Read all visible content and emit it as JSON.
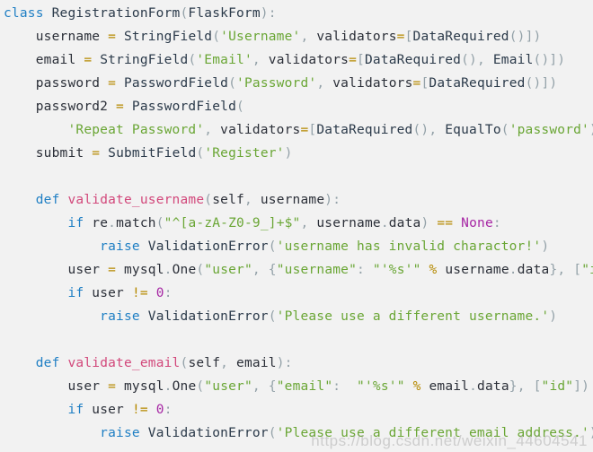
{
  "editor": {
    "background_color": "#f2f2f2",
    "language": "python",
    "font_size_px": 14.5,
    "line_height_px": 26
  },
  "colors": {
    "keyword": "#1f7fc4",
    "function_name": "#d2487b",
    "string": "#6aa635",
    "number": "#a626a4",
    "operator": "#b58900",
    "punctuation": "#93a1a8",
    "identifier": "#2b2f38",
    "background": "#f2f2f2",
    "watermark": "#a0a0a0"
  },
  "watermark": {
    "text": "https://blog.csdn.net/weixin_44604541"
  },
  "code": {
    "lines": [
      {
        "index": 1,
        "text": "class RegistrationForm(FlaskForm):",
        "tokens": [
          {
            "t": "class",
            "c": "tok-kw"
          },
          {
            "t": " ",
            "c": "tok-plain"
          },
          {
            "t": "RegistrationForm",
            "c": "tok-cls"
          },
          {
            "t": "(",
            "c": "tok-punc"
          },
          {
            "t": "FlaskForm",
            "c": "tok-cls"
          },
          {
            "t": ")",
            "c": "tok-punc"
          },
          {
            "t": ":",
            "c": "tok-punc"
          }
        ]
      },
      {
        "index": 2,
        "text": "    username = StringField('Username', validators=[DataRequired()])",
        "tokens": [
          {
            "t": "    ",
            "c": "tok-plain"
          },
          {
            "t": "username",
            "c": "tok-name"
          },
          {
            "t": " ",
            "c": "tok-plain"
          },
          {
            "t": "=",
            "c": "tok-op"
          },
          {
            "t": " ",
            "c": "tok-plain"
          },
          {
            "t": "StringField",
            "c": "tok-cls"
          },
          {
            "t": "(",
            "c": "tok-punc"
          },
          {
            "t": "'Username'",
            "c": "tok-str"
          },
          {
            "t": ",",
            "c": "tok-punc"
          },
          {
            "t": " ",
            "c": "tok-plain"
          },
          {
            "t": "validators",
            "c": "tok-name"
          },
          {
            "t": "=",
            "c": "tok-op"
          },
          {
            "t": "[",
            "c": "tok-punc"
          },
          {
            "t": "DataRequired",
            "c": "tok-cls"
          },
          {
            "t": "()])",
            "c": "tok-punc"
          }
        ]
      },
      {
        "index": 3,
        "text": "    email = StringField('Email', validators=[DataRequired(), Email()])",
        "tokens": [
          {
            "t": "    ",
            "c": "tok-plain"
          },
          {
            "t": "email",
            "c": "tok-name"
          },
          {
            "t": " ",
            "c": "tok-plain"
          },
          {
            "t": "=",
            "c": "tok-op"
          },
          {
            "t": " ",
            "c": "tok-plain"
          },
          {
            "t": "StringField",
            "c": "tok-cls"
          },
          {
            "t": "(",
            "c": "tok-punc"
          },
          {
            "t": "'Email'",
            "c": "tok-str"
          },
          {
            "t": ",",
            "c": "tok-punc"
          },
          {
            "t": " ",
            "c": "tok-plain"
          },
          {
            "t": "validators",
            "c": "tok-name"
          },
          {
            "t": "=",
            "c": "tok-op"
          },
          {
            "t": "[",
            "c": "tok-punc"
          },
          {
            "t": "DataRequired",
            "c": "tok-cls"
          },
          {
            "t": "(), ",
            "c": "tok-punc"
          },
          {
            "t": "Email",
            "c": "tok-cls"
          },
          {
            "t": "()])",
            "c": "tok-punc"
          }
        ]
      },
      {
        "index": 4,
        "text": "    password = PasswordField('Password', validators=[DataRequired()])",
        "tokens": [
          {
            "t": "    ",
            "c": "tok-plain"
          },
          {
            "t": "password",
            "c": "tok-name"
          },
          {
            "t": " ",
            "c": "tok-plain"
          },
          {
            "t": "=",
            "c": "tok-op"
          },
          {
            "t": " ",
            "c": "tok-plain"
          },
          {
            "t": "PasswordField",
            "c": "tok-cls"
          },
          {
            "t": "(",
            "c": "tok-punc"
          },
          {
            "t": "'Password'",
            "c": "tok-str"
          },
          {
            "t": ",",
            "c": "tok-punc"
          },
          {
            "t": " ",
            "c": "tok-plain"
          },
          {
            "t": "validators",
            "c": "tok-name"
          },
          {
            "t": "=",
            "c": "tok-op"
          },
          {
            "t": "[",
            "c": "tok-punc"
          },
          {
            "t": "DataRequired",
            "c": "tok-cls"
          },
          {
            "t": "()])",
            "c": "tok-punc"
          }
        ]
      },
      {
        "index": 5,
        "text": "    password2 = PasswordField(",
        "tokens": [
          {
            "t": "    ",
            "c": "tok-plain"
          },
          {
            "t": "password2",
            "c": "tok-name"
          },
          {
            "t": " ",
            "c": "tok-plain"
          },
          {
            "t": "=",
            "c": "tok-op"
          },
          {
            "t": " ",
            "c": "tok-plain"
          },
          {
            "t": "PasswordField",
            "c": "tok-cls"
          },
          {
            "t": "(",
            "c": "tok-punc"
          }
        ]
      },
      {
        "index": 6,
        "text": "        'Repeat Password', validators=[DataRequired(), EqualTo('password')])",
        "tokens": [
          {
            "t": "        ",
            "c": "tok-plain"
          },
          {
            "t": "'Repeat Password'",
            "c": "tok-str"
          },
          {
            "t": ",",
            "c": "tok-punc"
          },
          {
            "t": " ",
            "c": "tok-plain"
          },
          {
            "t": "validators",
            "c": "tok-name"
          },
          {
            "t": "=",
            "c": "tok-op"
          },
          {
            "t": "[",
            "c": "tok-punc"
          },
          {
            "t": "DataRequired",
            "c": "tok-cls"
          },
          {
            "t": "(), ",
            "c": "tok-punc"
          },
          {
            "t": "EqualTo",
            "c": "tok-cls"
          },
          {
            "t": "(",
            "c": "tok-punc"
          },
          {
            "t": "'password'",
            "c": "tok-str"
          },
          {
            "t": ")])",
            "c": "tok-punc"
          }
        ]
      },
      {
        "index": 7,
        "text": "    submit = SubmitField('Register')",
        "tokens": [
          {
            "t": "    ",
            "c": "tok-plain"
          },
          {
            "t": "submit",
            "c": "tok-name"
          },
          {
            "t": " ",
            "c": "tok-plain"
          },
          {
            "t": "=",
            "c": "tok-op"
          },
          {
            "t": " ",
            "c": "tok-plain"
          },
          {
            "t": "SubmitField",
            "c": "tok-cls"
          },
          {
            "t": "(",
            "c": "tok-punc"
          },
          {
            "t": "'Register'",
            "c": "tok-str"
          },
          {
            "t": ")",
            "c": "tok-punc"
          }
        ]
      },
      {
        "index": 8,
        "text": "",
        "tokens": []
      },
      {
        "index": 9,
        "text": "    def validate_username(self, username):",
        "tokens": [
          {
            "t": "    ",
            "c": "tok-plain"
          },
          {
            "t": "def",
            "c": "tok-kw"
          },
          {
            "t": " ",
            "c": "tok-plain"
          },
          {
            "t": "validate_username",
            "c": "tok-fname"
          },
          {
            "t": "(",
            "c": "tok-punc"
          },
          {
            "t": "self",
            "c": "tok-name"
          },
          {
            "t": ",",
            "c": "tok-punc"
          },
          {
            "t": " ",
            "c": "tok-plain"
          },
          {
            "t": "username",
            "c": "tok-name"
          },
          {
            "t": "):",
            "c": "tok-punc"
          }
        ]
      },
      {
        "index": 10,
        "text": "        if re.match(\"^[a-zA-Z0-9_]+$\", username.data) == None:",
        "tokens": [
          {
            "t": "        ",
            "c": "tok-plain"
          },
          {
            "t": "if",
            "c": "tok-kw"
          },
          {
            "t": " ",
            "c": "tok-plain"
          },
          {
            "t": "re",
            "c": "tok-name"
          },
          {
            "t": ".",
            "c": "tok-punc"
          },
          {
            "t": "match",
            "c": "tok-name"
          },
          {
            "t": "(",
            "c": "tok-punc"
          },
          {
            "t": "\"^[a-zA-Z0-9_]+$\"",
            "c": "tok-str"
          },
          {
            "t": ",",
            "c": "tok-punc"
          },
          {
            "t": " ",
            "c": "tok-plain"
          },
          {
            "t": "username",
            "c": "tok-name"
          },
          {
            "t": ".",
            "c": "tok-punc"
          },
          {
            "t": "data",
            "c": "tok-name"
          },
          {
            "t": ")",
            "c": "tok-punc"
          },
          {
            "t": " ",
            "c": "tok-plain"
          },
          {
            "t": "==",
            "c": "tok-op"
          },
          {
            "t": " ",
            "c": "tok-plain"
          },
          {
            "t": "None",
            "c": "tok-num"
          },
          {
            "t": ":",
            "c": "tok-punc"
          }
        ]
      },
      {
        "index": 11,
        "text": "            raise ValidationError('username has invalid charactor!')",
        "tokens": [
          {
            "t": "            ",
            "c": "tok-plain"
          },
          {
            "t": "raise",
            "c": "tok-kw"
          },
          {
            "t": " ",
            "c": "tok-plain"
          },
          {
            "t": "ValidationError",
            "c": "tok-cls"
          },
          {
            "t": "(",
            "c": "tok-punc"
          },
          {
            "t": "'username has invalid charactor!'",
            "c": "tok-str"
          },
          {
            "t": ")",
            "c": "tok-punc"
          }
        ]
      },
      {
        "index": 12,
        "text": "        user = mysql.One(\"user\", {\"username\": \"'%s'\" % username.data}, [\"id\"])",
        "tokens": [
          {
            "t": "        ",
            "c": "tok-plain"
          },
          {
            "t": "user",
            "c": "tok-name"
          },
          {
            "t": " ",
            "c": "tok-plain"
          },
          {
            "t": "=",
            "c": "tok-op"
          },
          {
            "t": " ",
            "c": "tok-plain"
          },
          {
            "t": "mysql",
            "c": "tok-name"
          },
          {
            "t": ".",
            "c": "tok-punc"
          },
          {
            "t": "One",
            "c": "tok-name"
          },
          {
            "t": "(",
            "c": "tok-punc"
          },
          {
            "t": "\"user\"",
            "c": "tok-str"
          },
          {
            "t": ", ",
            "c": "tok-punc"
          },
          {
            "t": "{",
            "c": "tok-punc"
          },
          {
            "t": "\"username\"",
            "c": "tok-str"
          },
          {
            "t": ": ",
            "c": "tok-punc"
          },
          {
            "t": "\"'%s'\"",
            "c": "tok-str"
          },
          {
            "t": " ",
            "c": "tok-plain"
          },
          {
            "t": "%",
            "c": "tok-op"
          },
          {
            "t": " ",
            "c": "tok-plain"
          },
          {
            "t": "username",
            "c": "tok-name"
          },
          {
            "t": ".",
            "c": "tok-punc"
          },
          {
            "t": "data",
            "c": "tok-name"
          },
          {
            "t": "}, [",
            "c": "tok-punc"
          },
          {
            "t": "\"id\"",
            "c": "tok-str"
          },
          {
            "t": "])",
            "c": "tok-punc"
          }
        ]
      },
      {
        "index": 13,
        "text": "        if user != 0:",
        "tokens": [
          {
            "t": "        ",
            "c": "tok-plain"
          },
          {
            "t": "if",
            "c": "tok-kw"
          },
          {
            "t": " ",
            "c": "tok-plain"
          },
          {
            "t": "user",
            "c": "tok-name"
          },
          {
            "t": " ",
            "c": "tok-plain"
          },
          {
            "t": "!=",
            "c": "tok-op"
          },
          {
            "t": " ",
            "c": "tok-plain"
          },
          {
            "t": "0",
            "c": "tok-num"
          },
          {
            "t": ":",
            "c": "tok-punc"
          }
        ]
      },
      {
        "index": 14,
        "text": "            raise ValidationError('Please use a different username.')",
        "tokens": [
          {
            "t": "            ",
            "c": "tok-plain"
          },
          {
            "t": "raise",
            "c": "tok-kw"
          },
          {
            "t": " ",
            "c": "tok-plain"
          },
          {
            "t": "ValidationError",
            "c": "tok-cls"
          },
          {
            "t": "(",
            "c": "tok-punc"
          },
          {
            "t": "'Please use a different username.'",
            "c": "tok-str"
          },
          {
            "t": ")",
            "c": "tok-punc"
          }
        ]
      },
      {
        "index": 15,
        "text": "",
        "tokens": []
      },
      {
        "index": 16,
        "text": "    def validate_email(self, email):",
        "tokens": [
          {
            "t": "    ",
            "c": "tok-plain"
          },
          {
            "t": "def",
            "c": "tok-kw"
          },
          {
            "t": " ",
            "c": "tok-plain"
          },
          {
            "t": "validate_email",
            "c": "tok-fname"
          },
          {
            "t": "(",
            "c": "tok-punc"
          },
          {
            "t": "self",
            "c": "tok-name"
          },
          {
            "t": ",",
            "c": "tok-punc"
          },
          {
            "t": " ",
            "c": "tok-plain"
          },
          {
            "t": "email",
            "c": "tok-name"
          },
          {
            "t": "):",
            "c": "tok-punc"
          }
        ]
      },
      {
        "index": 17,
        "text": "        user = mysql.One(\"user\", {\"email\":  \"'%s'\" % email.data}, [\"id\"])",
        "tokens": [
          {
            "t": "        ",
            "c": "tok-plain"
          },
          {
            "t": "user",
            "c": "tok-name"
          },
          {
            "t": " ",
            "c": "tok-plain"
          },
          {
            "t": "=",
            "c": "tok-op"
          },
          {
            "t": " ",
            "c": "tok-plain"
          },
          {
            "t": "mysql",
            "c": "tok-name"
          },
          {
            "t": ".",
            "c": "tok-punc"
          },
          {
            "t": "One",
            "c": "tok-name"
          },
          {
            "t": "(",
            "c": "tok-punc"
          },
          {
            "t": "\"user\"",
            "c": "tok-str"
          },
          {
            "t": ", ",
            "c": "tok-punc"
          },
          {
            "t": "{",
            "c": "tok-punc"
          },
          {
            "t": "\"email\"",
            "c": "tok-str"
          },
          {
            "t": ":  ",
            "c": "tok-punc"
          },
          {
            "t": "\"'%s'\"",
            "c": "tok-str"
          },
          {
            "t": " ",
            "c": "tok-plain"
          },
          {
            "t": "%",
            "c": "tok-op"
          },
          {
            "t": " ",
            "c": "tok-plain"
          },
          {
            "t": "email",
            "c": "tok-name"
          },
          {
            "t": ".",
            "c": "tok-punc"
          },
          {
            "t": "data",
            "c": "tok-name"
          },
          {
            "t": "}, [",
            "c": "tok-punc"
          },
          {
            "t": "\"id\"",
            "c": "tok-str"
          },
          {
            "t": "])",
            "c": "tok-punc"
          }
        ]
      },
      {
        "index": 18,
        "text": "        if user != 0:",
        "tokens": [
          {
            "t": "        ",
            "c": "tok-plain"
          },
          {
            "t": "if",
            "c": "tok-kw"
          },
          {
            "t": " ",
            "c": "tok-plain"
          },
          {
            "t": "user",
            "c": "tok-name"
          },
          {
            "t": " ",
            "c": "tok-plain"
          },
          {
            "t": "!=",
            "c": "tok-op"
          },
          {
            "t": " ",
            "c": "tok-plain"
          },
          {
            "t": "0",
            "c": "tok-num"
          },
          {
            "t": ":",
            "c": "tok-punc"
          }
        ]
      },
      {
        "index": 19,
        "text": "            raise ValidationError('Please use a different email address.')",
        "tokens": [
          {
            "t": "            ",
            "c": "tok-plain"
          },
          {
            "t": "raise",
            "c": "tok-kw"
          },
          {
            "t": " ",
            "c": "tok-plain"
          },
          {
            "t": "ValidationError",
            "c": "tok-cls"
          },
          {
            "t": "(",
            "c": "tok-punc"
          },
          {
            "t": "'Please use a different email address.'",
            "c": "tok-str"
          },
          {
            "t": ")",
            "c": "tok-punc"
          }
        ]
      }
    ]
  }
}
